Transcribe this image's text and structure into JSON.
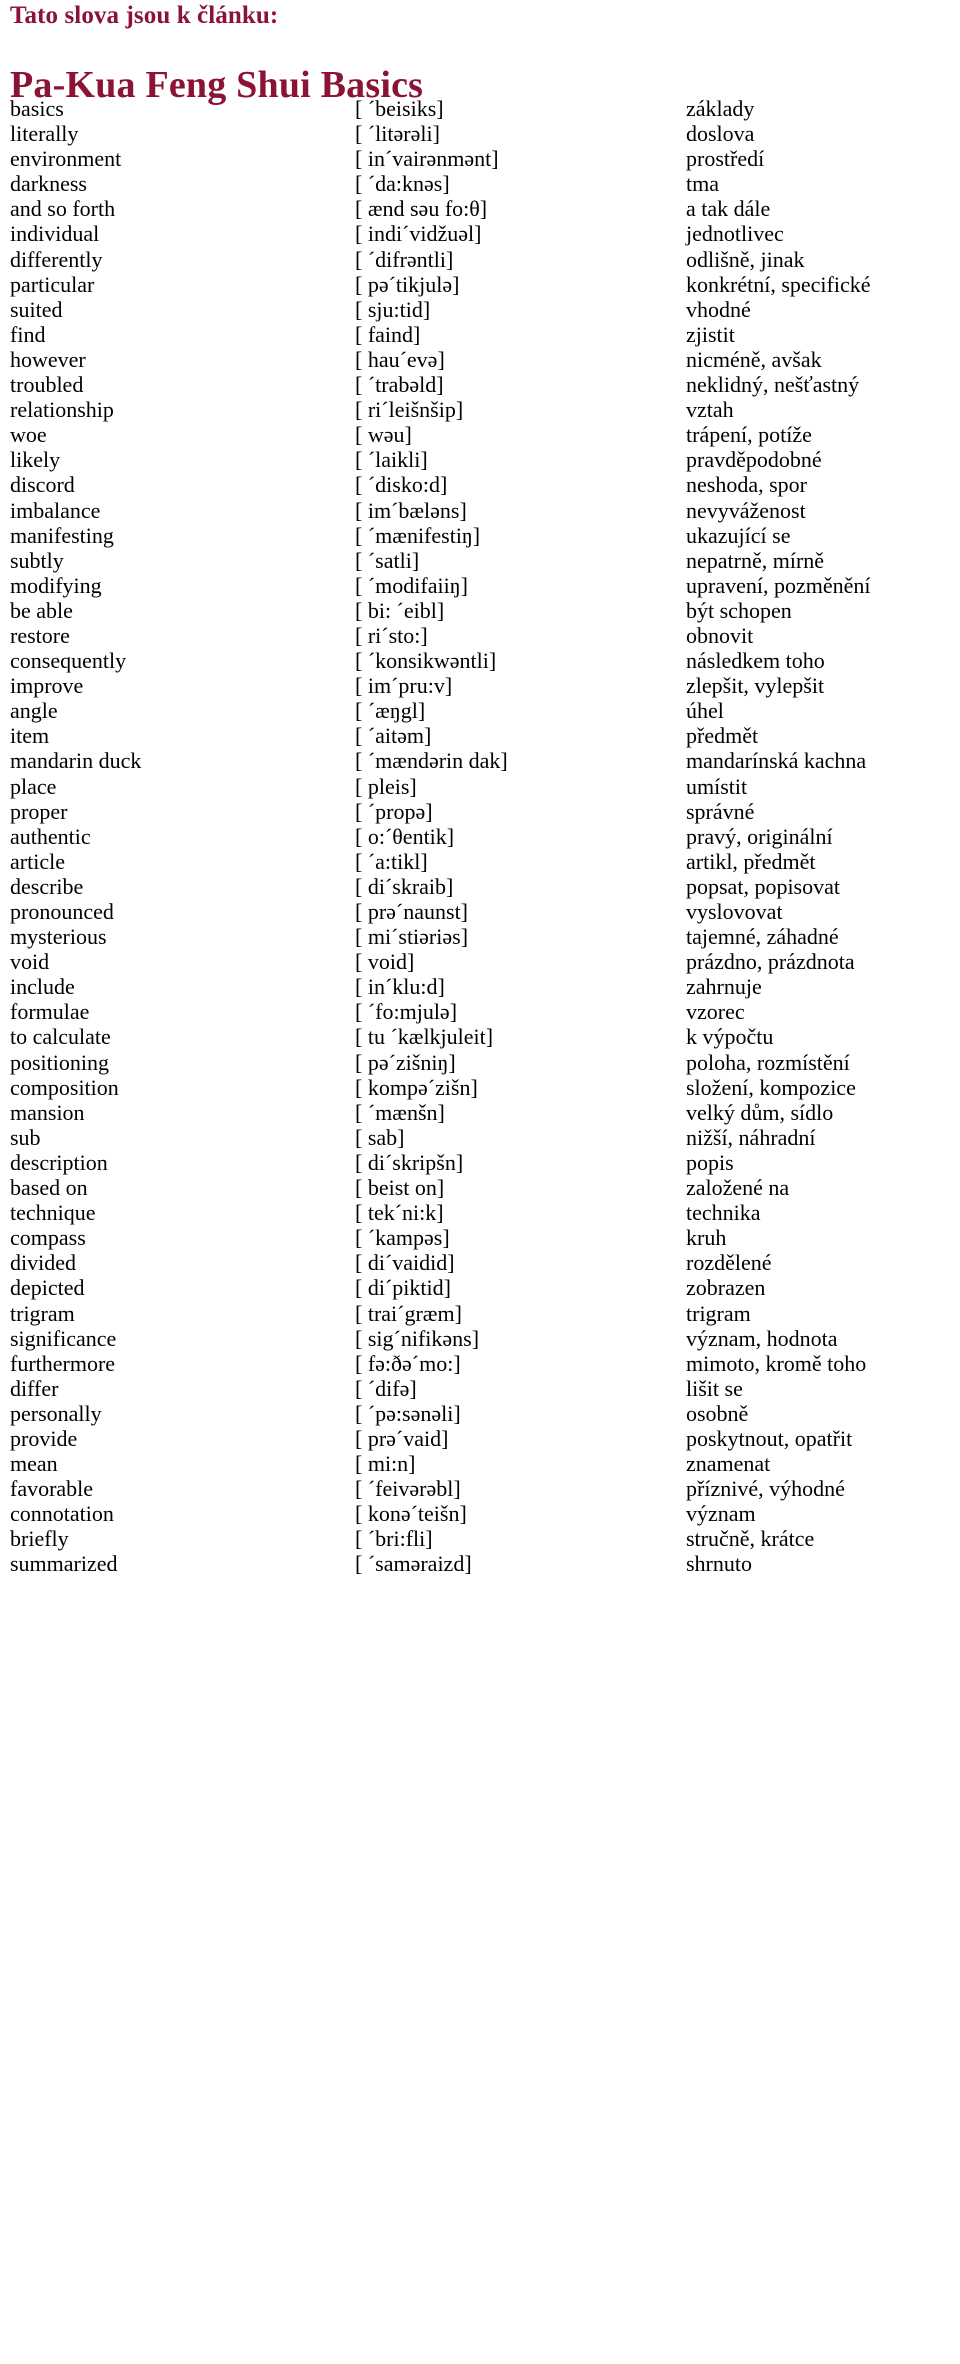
{
  "header": {
    "kicker": "Tato slova jsou k článku:",
    "title": "Pa-Kua Feng Shui Basics",
    "accent_color": "#8B1335"
  },
  "vocabulary": {
    "columns": [
      "term",
      "phonetic",
      "translation"
    ],
    "rows": [
      {
        "term": "basics",
        "phonetic": "[ ˊbeisiks]",
        "translation": "základy"
      },
      {
        "term": "literally",
        "phonetic": "[ ˊlitərəli]",
        "translation": "doslova"
      },
      {
        "term": "environment",
        "phonetic": "[ inˊvairənmənt]",
        "translation": "prostředí"
      },
      {
        "term": "darkness",
        "phonetic": "[ ˊda:knəs]",
        "translation": "tma"
      },
      {
        "term": "and so forth",
        "phonetic": "[ ænd səu fo:θ]",
        "translation": "a tak dále"
      },
      {
        "term": "individual",
        "phonetic": "[ indiˊvidžuəl]",
        "translation": "jednotlivec"
      },
      {
        "term": "differently",
        "phonetic": "[ ˊdifrəntli]",
        "translation": "odlišně, jinak"
      },
      {
        "term": "particular",
        "phonetic": "[ pəˊtikjulə]",
        "translation": "konkrétní, specifické"
      },
      {
        "term": "suited",
        "phonetic": "[ sju:tid]",
        "translation": "vhodné"
      },
      {
        "term": "find",
        "phonetic": "[ faind]",
        "translation": "zjistit"
      },
      {
        "term": "however",
        "phonetic": "[ hauˊevə]",
        "translation": "nicméně, avšak"
      },
      {
        "term": "troubled",
        "phonetic": "[ ˊtrabəld]",
        "translation": "neklidný, nešťastný"
      },
      {
        "term": "relationship",
        "phonetic": "[ riˊleišnšip]",
        "translation": "vztah"
      },
      {
        "term": "woe",
        "phonetic": "[ wəu]",
        "translation": "trápení, potíže"
      },
      {
        "term": "likely",
        "phonetic": "[ ˊlaikli]",
        "translation": "pravděpodobné"
      },
      {
        "term": "discord",
        "phonetic": "[ ˊdisko:d]",
        "translation": "neshoda, spor"
      },
      {
        "term": "imbalance",
        "phonetic": "[ imˊbæləns]",
        "translation": "nevyváženost"
      },
      {
        "term": "manifesting",
        "phonetic": "[ ˊmænifestiŋ]",
        "translation": "ukazující se"
      },
      {
        "term": "subtly",
        "phonetic": "[ ˊsatli]",
        "translation": "nepatrně, mírně"
      },
      {
        "term": "modifying",
        "phonetic": "[ ˊmodifaiiŋ]",
        "translation": "upravení, pozměnění"
      },
      {
        "term": "be able",
        "phonetic": "[ bi: ˊeibl]",
        "translation": "být schopen"
      },
      {
        "term": "restore",
        "phonetic": "[ riˊsto:]",
        "translation": "obnovit"
      },
      {
        "term": "consequently",
        "phonetic": "[ ˊkonsikwəntli]",
        "translation": "následkem toho"
      },
      {
        "term": "improve",
        "phonetic": "[ imˊpru:v]",
        "translation": "zlepšit, vylepšit"
      },
      {
        "term": "angle",
        "phonetic": "[ ˊæŋgl]",
        "translation": "úhel"
      },
      {
        "term": "item",
        "phonetic": "[ ˊaitəm]",
        "translation": "předmět"
      },
      {
        "term": "mandarin duck",
        "phonetic": "[ ˊmændərin dak]",
        "translation": "mandarínská kachna"
      },
      {
        "term": "place",
        "phonetic": "[ pleis]",
        "translation": "umístit"
      },
      {
        "term": "proper",
        "phonetic": "[ ˊpropə]",
        "translation": "správné"
      },
      {
        "term": "authentic",
        "phonetic": "[ o:ˊθentik]",
        "translation": "pravý, originální"
      },
      {
        "term": "article",
        "phonetic": "[ ˊa:tikl]",
        "translation": "artikl, předmět"
      },
      {
        "term": "describe",
        "phonetic": "[ diˊskraib]",
        "translation": "popsat, popisovat"
      },
      {
        "term": "pronounced",
        "phonetic": "[ prəˊnaunst]",
        "translation": "vyslovovat"
      },
      {
        "term": "mysterious",
        "phonetic": "[ miˊstiəriəs]",
        "translation": "tajemné, záhadné"
      },
      {
        "term": "void",
        "phonetic": "[ void]",
        "translation": "prázdno, prázdnota"
      },
      {
        "term": "include",
        "phonetic": "[ inˊklu:d]",
        "translation": "zahrnuje"
      },
      {
        "term": "formulae",
        "phonetic": "[ ˊfo:mjulə]",
        "translation": "vzorec"
      },
      {
        "term": "to calculate",
        "phonetic": "[ tu ˊkælkjuleit]",
        "translation": "k výpočtu"
      },
      {
        "term": "positioning",
        "phonetic": "[ pəˊzišniŋ]",
        "translation": "poloha, rozmístění"
      },
      {
        "term": "composition",
        "phonetic": "[ kompəˊzišn]",
        "translation": "složení, kompozice"
      },
      {
        "term": "mansion",
        "phonetic": "[ ˊmænšn]",
        "translation": "velký dům, sídlo"
      },
      {
        "term": "sub",
        "phonetic": "[ sab]",
        "translation": "nižší, náhradní"
      },
      {
        "term": "description",
        "phonetic": "[ diˊskripšn]",
        "translation": "popis"
      },
      {
        "term": "based on",
        "phonetic": "[ beist on]",
        "translation": "založené na"
      },
      {
        "term": "technique",
        "phonetic": "[ tekˊni:k]",
        "translation": "technika"
      },
      {
        "term": "compass",
        "phonetic": "[ ˊkampəs]",
        "translation": "kruh"
      },
      {
        "term": "divided",
        "phonetic": "[ diˊvaidid]",
        "translation": "rozdělené"
      },
      {
        "term": "depicted",
        "phonetic": "[ diˊpiktid]",
        "translation": "zobrazen"
      },
      {
        "term": "trigram",
        "phonetic": "[ traiˊgræm]",
        "translation": "trigram"
      },
      {
        "term": "significance",
        "phonetic": "[ sigˊnifikəns]",
        "translation": "význam, hodnota"
      },
      {
        "term": "furthermore",
        "phonetic": "[ fə:ðəˊmo:]",
        "translation": "mimoto, kromě toho"
      },
      {
        "term": "differ",
        "phonetic": "[ ˊdifə]",
        "translation": "lišit se"
      },
      {
        "term": "personally",
        "phonetic": "[ ˊpə:sənəli]",
        "translation": "osobně"
      },
      {
        "term": "provide",
        "phonetic": "[ prəˊvaid]",
        "translation": "poskytnout, opatřit"
      },
      {
        "term": "mean",
        "phonetic": "[ mi:n]",
        "translation": "znamenat"
      },
      {
        "term": "favorable",
        "phonetic": "[ ˊfeivərəbl]",
        "translation": "příznivé, výhodné"
      },
      {
        "term": "connotation",
        "phonetic": "[ konəˊteišn]",
        "translation": "význam"
      },
      {
        "term": "briefly",
        "phonetic": "[ ˊbri:fli]",
        "translation": "stručně, krátce"
      },
      {
        "term": "summarized",
        "phonetic": "[ ˊsaməraizd]",
        "translation": "shrnuto"
      }
    ]
  }
}
